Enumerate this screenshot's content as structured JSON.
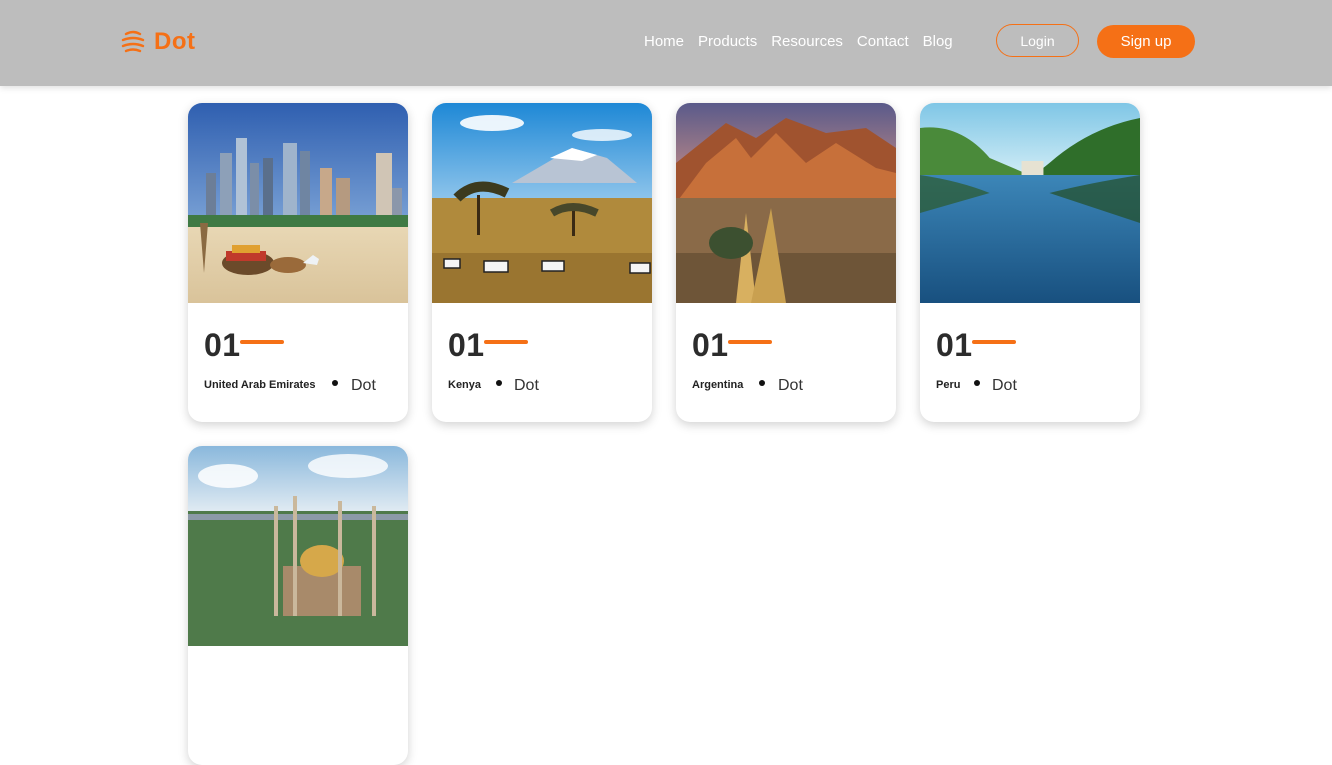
{
  "brand": {
    "name": "Dot",
    "logo_icon": "globe-stack-icon",
    "accent_color": "#f57016"
  },
  "nav": {
    "links": [
      {
        "label": "Home"
      },
      {
        "label": "Products"
      },
      {
        "label": "Resources"
      },
      {
        "label": "Contact"
      },
      {
        "label": "Blog"
      }
    ],
    "login_label": "Login",
    "signup_label": "Sign up"
  },
  "cards": [
    {
      "number": "01",
      "country": "United Arab Emirates",
      "brand": "Dot",
      "image": "desert-city-skyline-camels"
    },
    {
      "number": "01",
      "country": "Kenya",
      "brand": "Dot",
      "image": "savanna-zebras-mountain"
    },
    {
      "number": "01",
      "country": "Argentina",
      "brand": "Dot",
      "image": "red-rock-badlands"
    },
    {
      "number": "01",
      "country": "Peru",
      "brand": "Dot",
      "image": "reflecting-pool-trees"
    },
    {
      "number": "",
      "country": "",
      "brand": "",
      "image": "mosque-golden-dome-city"
    }
  ]
}
